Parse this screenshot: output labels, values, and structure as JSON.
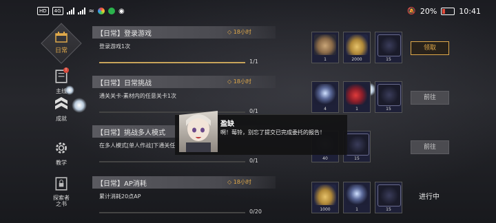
{
  "status_bar": {
    "left_tag1": "HD",
    "left_tag2": "4G",
    "battery": "20%",
    "time": "10:41",
    "battery_level": 0.2
  },
  "sidebar": {
    "items": [
      {
        "label": "日常",
        "icon": "calendar-icon",
        "active": true
      },
      {
        "label": "主线",
        "icon": "book-icon",
        "badge": "!"
      },
      {
        "label": "成就",
        "icon": "rank-chevron-icon"
      },
      {
        "label": "教学",
        "icon": "gear-icon"
      },
      {
        "label": "探索者\n之书",
        "icon": "locked-book-icon"
      }
    ]
  },
  "tasks": [
    {
      "title": "【日常】登录游戏",
      "timer": "18小时",
      "desc": "登录游戏1次",
      "progress_text": "1/1",
      "progress": 1.0,
      "rewards": [
        {
          "icon": "pocket-watch-icon",
          "count": "1"
        },
        {
          "icon": "gold-coins-icon",
          "count": "2000"
        },
        {
          "icon": "star-badge-icon",
          "count": "15"
        }
      ],
      "button": "领取",
      "button_type": "claim"
    },
    {
      "title": "【日常】日常挑战",
      "timer": "18小时",
      "desc": "通关关卡-素材内的任意关卡1次",
      "progress_text": "0/1",
      "progress": 0.0,
      "rewards": [
        {
          "icon": "crystal-ball-icon",
          "count": "4"
        },
        {
          "icon": "red-potion-icon",
          "count": "1"
        },
        {
          "icon": "star-badge-icon",
          "count": "15"
        }
      ],
      "button": "前往",
      "button_type": "go"
    },
    {
      "title": "【日常】挑战多人模式",
      "timer": "",
      "desc": "在多人模式[单人作战]下通关任",
      "progress_text": "0/1",
      "progress": 0.0,
      "rewards": [
        {
          "icon": "item-icon",
          "count": "40"
        },
        {
          "icon": "star-badge-icon",
          "count": "15"
        }
      ],
      "button": "前往",
      "button_type": "go"
    },
    {
      "title": "【日常】AP消耗",
      "timer": "18小时",
      "desc": "累计消耗20点AP",
      "progress_text": "0/20",
      "progress": 0.0,
      "rewards": [
        {
          "icon": "gold-coins-icon",
          "count": "1000"
        },
        {
          "icon": "crystal-ball-icon",
          "count": "1"
        },
        {
          "icon": "star-badge-icon",
          "count": "15"
        }
      ],
      "button": "进行中",
      "button_type": "progress"
    }
  ],
  "dialog": {
    "speaker": "盈缺",
    "text": "啊！莓铃，别忘了提交已完成委托的报告！"
  },
  "colors": {
    "accent_gold": "#e0a94a",
    "badge_red": "#d8483a"
  }
}
